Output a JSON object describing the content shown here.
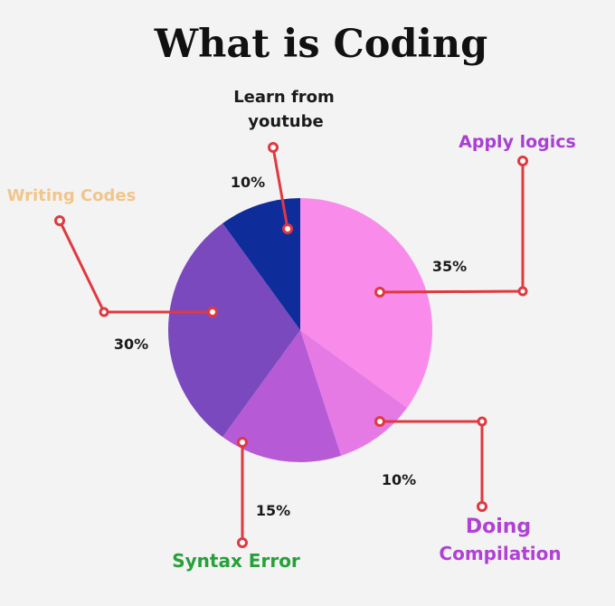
{
  "chart_data": {
    "type": "pie",
    "title": "What is Coding",
    "slices": [
      {
        "label": "Apply logics",
        "value": 35,
        "value_label": "35%",
        "color": "#f98ceb",
        "label_color": "#a93fd3"
      },
      {
        "label": "Doing Compilation",
        "label_lines": [
          "Doing",
          "Compilation"
        ],
        "value": 10,
        "value_label": "10%",
        "color": "#e57ae4",
        "label_color": "#b041d4"
      },
      {
        "label": "Syntax Error",
        "value": 15,
        "value_label": "15%",
        "color": "#b75ad6",
        "label_color": "#27a03a"
      },
      {
        "label": "Writing Codes",
        "value": 30,
        "value_label": "30%",
        "color": "#7b49be",
        "label_color": "#f2c58a"
      },
      {
        "label": "Learn from youtube",
        "label_lines": [
          "Learn from",
          "youtube"
        ],
        "value": 10,
        "value_label": "10%",
        "color": "#0e2d9b",
        "label_color": "#1b1b1b"
      }
    ]
  }
}
